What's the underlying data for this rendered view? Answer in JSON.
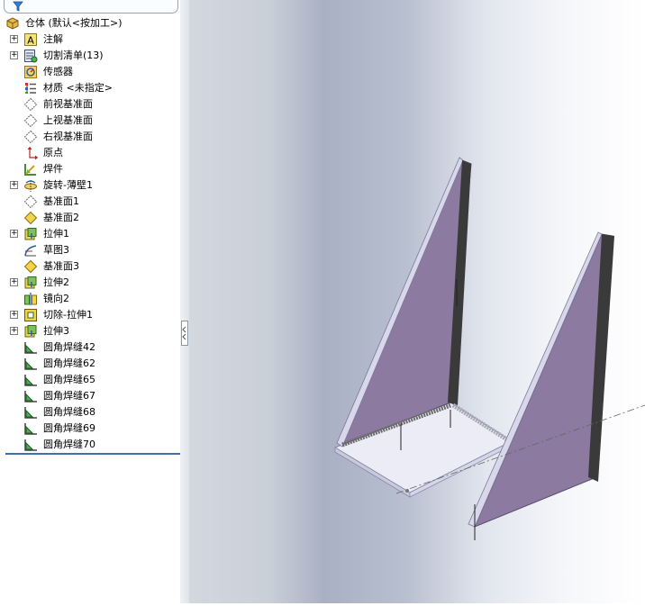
{
  "feature_tree": {
    "root_label": "仓体  (默认<按加工>)",
    "items": [
      {
        "label": "注解",
        "icon": "annotations-icon",
        "expandable": true
      },
      {
        "label": "切割清单(13)",
        "icon": "cut-list-icon",
        "expandable": true
      },
      {
        "label": "传感器",
        "icon": "sensor-icon",
        "expandable": false
      },
      {
        "label": "材质 <未指定>",
        "icon": "material-icon",
        "expandable": false
      },
      {
        "label": "前视基准面",
        "icon": "plane-icon",
        "expandable": false
      },
      {
        "label": "上视基准面",
        "icon": "plane-icon",
        "expandable": false
      },
      {
        "label": "右视基准面",
        "icon": "plane-icon",
        "expandable": false
      },
      {
        "label": "原点",
        "icon": "origin-icon",
        "expandable": false
      },
      {
        "label": "焊件",
        "icon": "weldment-icon",
        "expandable": false
      },
      {
        "label": "旋转-薄壁1",
        "icon": "revolve-thin-icon",
        "expandable": true
      },
      {
        "label": "基准面1",
        "icon": "plane-icon",
        "expandable": false
      },
      {
        "label": "基准面2",
        "icon": "plane-yellow-icon",
        "expandable": false
      },
      {
        "label": "拉伸1",
        "icon": "extrude-icon",
        "expandable": true
      },
      {
        "label": "草图3",
        "icon": "sketch-icon",
        "expandable": false
      },
      {
        "label": "基准面3",
        "icon": "plane-yellow-icon",
        "expandable": false
      },
      {
        "label": "拉伸2",
        "icon": "extrude-icon",
        "expandable": true
      },
      {
        "label": "镜向2",
        "icon": "mirror-icon",
        "expandable": false
      },
      {
        "label": "切除-拉伸1",
        "icon": "cut-extrude-icon",
        "expandable": true
      },
      {
        "label": "拉伸3",
        "icon": "extrude-icon",
        "expandable": true
      },
      {
        "label": "圆角焊缝42",
        "icon": "fillet-weld-icon",
        "expandable": false
      },
      {
        "label": "圆角焊缝62",
        "icon": "fillet-weld-icon",
        "expandable": false
      },
      {
        "label": "圆角焊缝65",
        "icon": "fillet-weld-icon",
        "expandable": false
      },
      {
        "label": "圆角焊缝67",
        "icon": "fillet-weld-icon",
        "expandable": false
      },
      {
        "label": "圆角焊缝68",
        "icon": "fillet-weld-icon",
        "expandable": false
      },
      {
        "label": "圆角焊缝69",
        "icon": "fillet-weld-icon",
        "expandable": false
      },
      {
        "label": "圆角焊缝70",
        "icon": "fillet-weld-icon",
        "expandable": false
      }
    ]
  },
  "colors": {
    "accent": "#3b6fb0",
    "gusset_face": "#8c7aa0",
    "base_plate": "#e8e8f4",
    "weld_bead": "#3a3a3a"
  }
}
